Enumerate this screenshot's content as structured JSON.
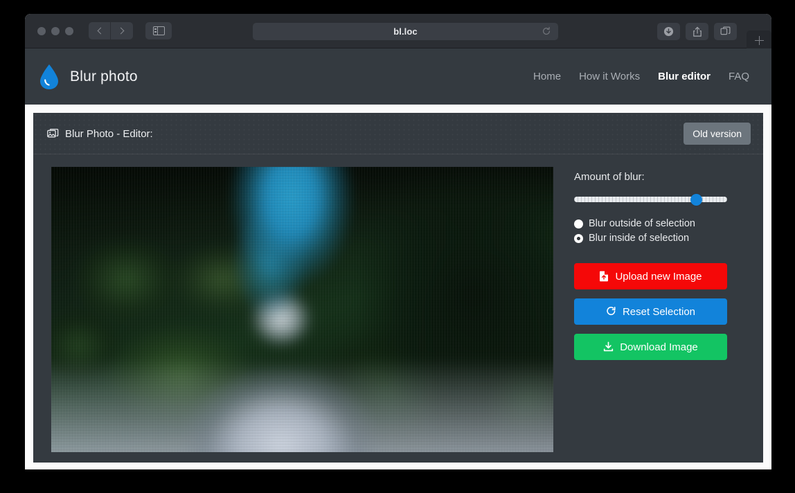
{
  "browser": {
    "url": "bl.loc",
    "traffic_lights": [
      "close",
      "minimize",
      "maximize"
    ],
    "back_label": "Back",
    "forward_label": "Forward",
    "sidebar_label": "Show Sidebar",
    "reload_label": "Reload",
    "downloads_label": "Downloads",
    "share_label": "Share",
    "tabs_label": "Tab Overview",
    "new_tab_label": "New Tab"
  },
  "site": {
    "brand": "Blur photo",
    "brand_icon": "water-droplet-icon",
    "brand_icon_color": "#1283da",
    "nav": [
      {
        "label": "Home",
        "active": false
      },
      {
        "label": "How it Works",
        "active": false
      },
      {
        "label": "Blur editor",
        "active": true
      },
      {
        "label": "FAQ",
        "active": false
      }
    ]
  },
  "card": {
    "title": "Blur Photo - Editor:",
    "title_icon": "images-icon",
    "old_version_label": "Old version"
  },
  "editor": {
    "image_alt": "Blurred photo of a road through a green forest with blue sky",
    "blur_label": "Amount of blur:",
    "slider": {
      "value": 78,
      "min": 0,
      "max": 100,
      "accent": "#1283da"
    },
    "radios": [
      {
        "label": "Blur outside of selection",
        "checked": false
      },
      {
        "label": "Blur inside of selection",
        "checked": true
      }
    ],
    "buttons": [
      {
        "label": "Upload new Image",
        "icon": "file-upload-icon",
        "color": "#f50808"
      },
      {
        "label": "Reset Selection",
        "icon": "redo-arrow-icon",
        "color": "#1283da"
      },
      {
        "label": "Download Image",
        "icon": "download-icon",
        "color": "#13c463"
      }
    ]
  },
  "theme": {
    "window_chrome": "#2b2e33",
    "header_bg": "#343a40",
    "card_bg": "#343a40",
    "page_bg": "#fbfbfb",
    "muted_text": "#a9aeb4"
  }
}
